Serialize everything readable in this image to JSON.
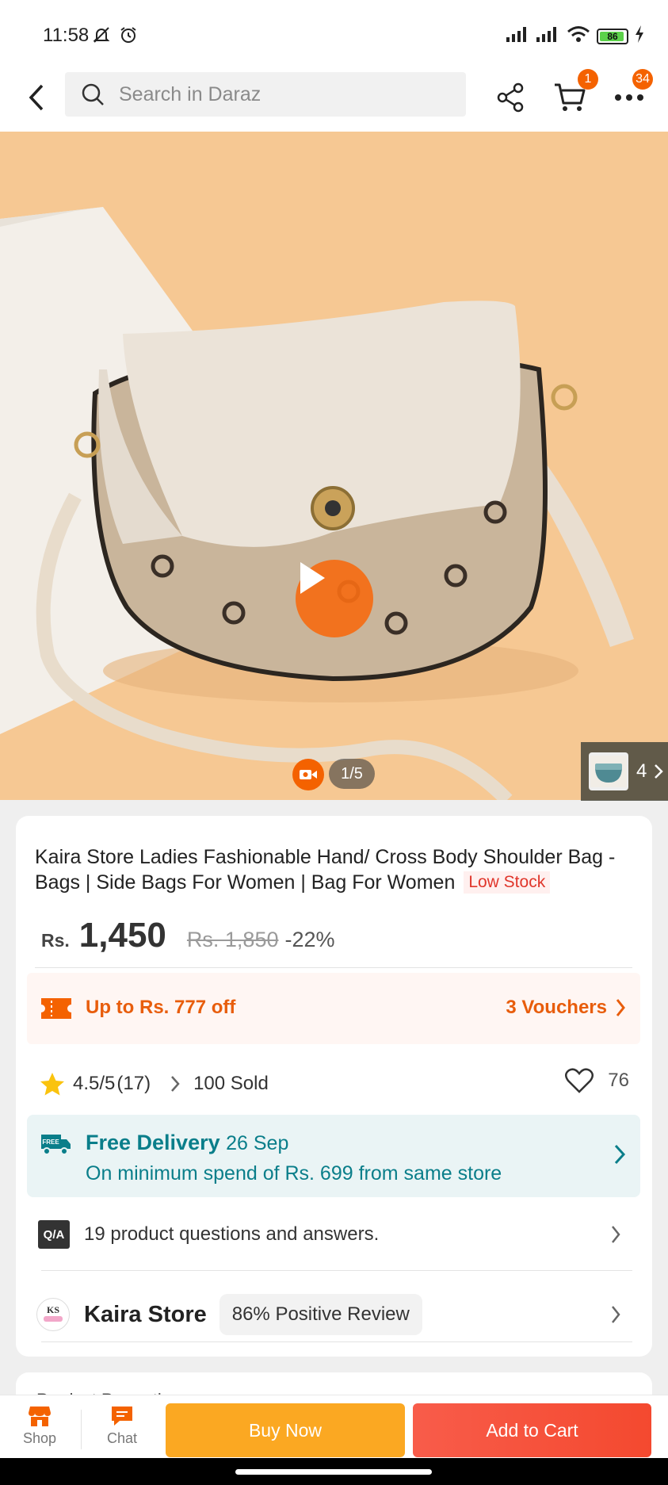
{
  "status_bar": {
    "time": "11:58",
    "battery": "86"
  },
  "top_nav": {
    "search_placeholder": "Search in Daraz",
    "cart_badge": "1",
    "more_badge": "34"
  },
  "gallery": {
    "counter": "1/5",
    "more_count": "4"
  },
  "product": {
    "title": "Kaira Store Ladies Fashionable Hand/ Cross Body Shoulder Bag - Bags | Side Bags For Women | Bag For Women",
    "stock_tag": "Low Stock",
    "currency": "Rs.",
    "price": "1,450",
    "old_price": "Rs. 1,850",
    "discount": "-22%"
  },
  "voucher": {
    "text": "Up to Rs. 777 off",
    "count": "3 Vouchers"
  },
  "rating": {
    "score": "4.5/5",
    "reviews": "(17)",
    "sold": "100 Sold",
    "wishlist_count": "76"
  },
  "delivery": {
    "title": "Free Delivery",
    "date": "26 Sep",
    "badge": "FREE",
    "subtitle": "On minimum spend of Rs. 699 from same store"
  },
  "qa": {
    "badge": "Q/A",
    "text": "19 product questions and answers."
  },
  "store": {
    "logo_text": "KS",
    "name": "Kaira Store",
    "review": "86% Positive Review"
  },
  "next_section": {
    "label": "Product Promotions"
  },
  "bottom_bar": {
    "shop": "Shop",
    "chat": "Chat",
    "buy_now": "Buy Now",
    "add_to_cart": "Add to Cart"
  },
  "colors": {
    "accent": "#f46200",
    "teal": "#0a7e8a",
    "buy": "#fba822",
    "cart": "#f4492f"
  }
}
